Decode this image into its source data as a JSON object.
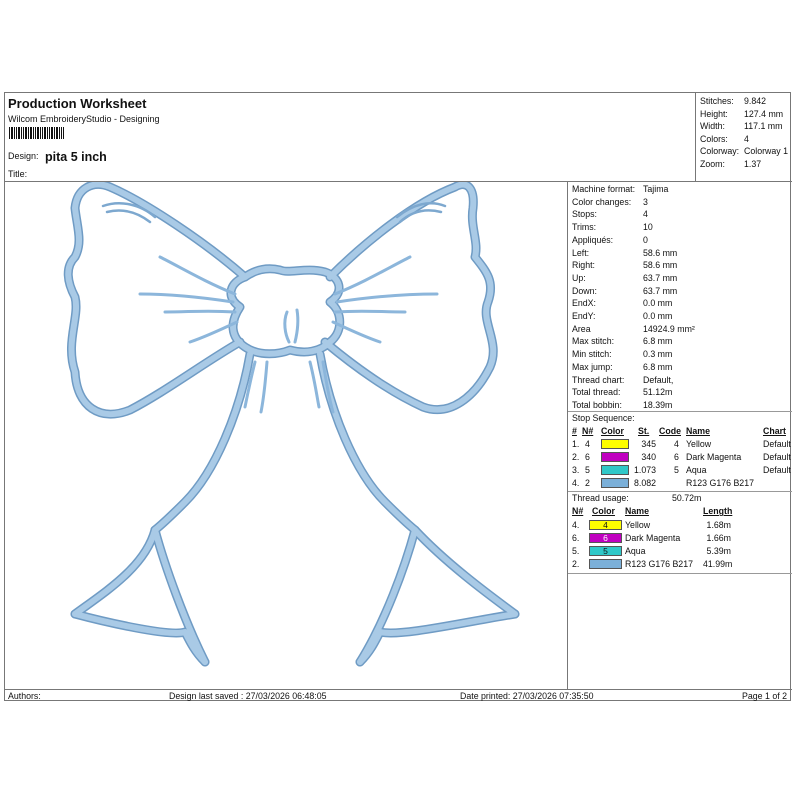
{
  "header": {
    "title": "Production Worksheet",
    "subtitle": "Wilcom EmbroideryStudio - Designing",
    "design_label": "Design:",
    "design_name": "pita 5 inch",
    "title_label": "Title:"
  },
  "stats": [
    {
      "key": "Stitches:",
      "value": "9.842"
    },
    {
      "key": "Height:",
      "value": "127.4 mm"
    },
    {
      "key": "Width:",
      "value": "117.1 mm"
    },
    {
      "key": "Colors:",
      "value": "4"
    },
    {
      "key": "Colorway:",
      "value": "Colorway 1"
    },
    {
      "key": "Zoom:",
      "value": "1.37"
    }
  ],
  "machine": [
    {
      "key": "Machine format:",
      "value": "Tajima"
    },
    {
      "key": "Color changes:",
      "value": "3"
    },
    {
      "key": "Stops:",
      "value": "4"
    },
    {
      "key": "Trims:",
      "value": "10"
    },
    {
      "key": "Appliqués:",
      "value": "0"
    },
    {
      "key": "Left:",
      "value": "58.6 mm"
    },
    {
      "key": "Right:",
      "value": "58.6 mm"
    },
    {
      "key": "Up:",
      "value": "63.7 mm"
    },
    {
      "key": "Down:",
      "value": "63.7 mm"
    },
    {
      "key": "EndX:",
      "value": "0.0 mm"
    },
    {
      "key": "EndY:",
      "value": "0.0 mm"
    },
    {
      "key": "Area",
      "value": "14924.9 mm²"
    },
    {
      "key": "Max stitch:",
      "value": "6.8 mm"
    },
    {
      "key": "Min stitch:",
      "value": "0.3 mm"
    },
    {
      "key": "Max jump:",
      "value": "6.8 mm"
    },
    {
      "key": "Thread chart:",
      "value": "Default,"
    },
    {
      "key": "Total thread:",
      "value": "51.12m"
    },
    {
      "key": "Total bobbin:",
      "value": "18.39m"
    }
  ],
  "stop_sequence": {
    "title": "Stop Sequence:",
    "headers": {
      "num": "#",
      "n": "N#",
      "color": "Color",
      "st": "St.",
      "code": "Code",
      "name": "Name",
      "chart": "Chart"
    },
    "rows": [
      {
        "num": "1.",
        "n": "4",
        "swatch": "#ffff00",
        "st": "345",
        "code": "4",
        "name": "Yellow",
        "chart": "Default"
      },
      {
        "num": "2.",
        "n": "6",
        "swatch": "#c000c0",
        "st": "340",
        "code": "6",
        "name": "Dark Magenta",
        "chart": "Default"
      },
      {
        "num": "3.",
        "n": "5",
        "swatch": "#30c8c8",
        "st": "1.073",
        "code": "5",
        "name": "Aqua",
        "chart": "Default"
      },
      {
        "num": "4.",
        "n": "2",
        "swatch": "#7bb0d9",
        "st": "8.082",
        "code": "",
        "name": "R123 G176 B217",
        "chart": ""
      }
    ]
  },
  "thread_usage": {
    "title": "Thread usage:",
    "total": "50.72m",
    "headers": {
      "n": "N#",
      "color": "Color",
      "name": "Name",
      "length": "Length"
    },
    "rows": [
      {
        "n": "4.",
        "swatch": "#ffff00",
        "label": "4",
        "name": "Yellow",
        "length": "1.68m"
      },
      {
        "n": "6.",
        "swatch": "#c000c0",
        "label": "6",
        "name": "Dark Magenta",
        "length": "1.66m"
      },
      {
        "n": "5.",
        "swatch": "#30c8c8",
        "label": "5",
        "name": "Aqua",
        "length": "5.39m"
      },
      {
        "n": "2.",
        "swatch": "#7bb0d9",
        "label": "",
        "name": "R123 G176 B217",
        "length": "41.99m"
      }
    ]
  },
  "footer": {
    "authors": "Authors:",
    "saved": "Design last saved : 27/03/2026 06:48:05",
    "printed": "Date printed: 27/03/2026 07:35:50",
    "page": "Page 1 of 2"
  },
  "colors": {
    "stitch_fill": "#9ec3e4",
    "stitch_edge": "#6f9bc4",
    "border": "#777777"
  }
}
